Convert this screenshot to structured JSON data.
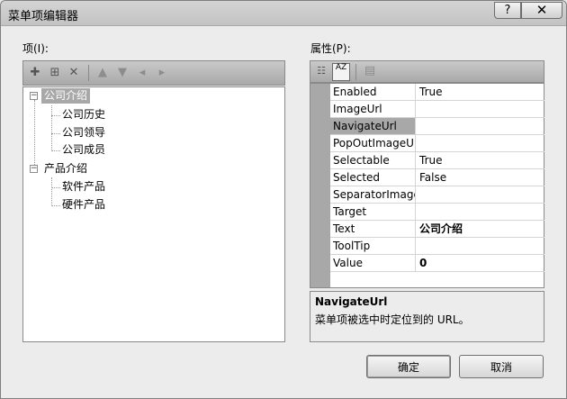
{
  "window": {
    "title": "菜单项编辑器",
    "help_label": "?",
    "close_label": "✕"
  },
  "items_panel": {
    "label": "项(I):",
    "toolbar_icons": [
      "add-root-item-icon",
      "add-child-item-icon",
      "delete-item-icon",
      "move-up-icon",
      "move-down-icon",
      "outdent-icon",
      "indent-icon"
    ],
    "tree": [
      {
        "label": "公司介绍",
        "selected": true,
        "children": [
          "公司历史",
          "公司领导",
          "公司成员"
        ]
      },
      {
        "label": "产品介绍",
        "selected": false,
        "children": [
          "软件产品",
          "硬件产品"
        ]
      }
    ]
  },
  "props_panel": {
    "label": "属性(P):",
    "toolbar_icons": [
      "categorized-icon",
      "alphabetical-sort-icon",
      "property-pages-icon"
    ],
    "sort_label": "AZ",
    "rows": [
      {
        "name": "Enabled",
        "value": "True",
        "bold": false
      },
      {
        "name": "ImageUrl",
        "value": "",
        "bold": false
      },
      {
        "name": "NavigateUrl",
        "value": "",
        "bold": false,
        "selected": true
      },
      {
        "name": "PopOutImageU",
        "value": "",
        "bold": false
      },
      {
        "name": "Selectable",
        "value": "True",
        "bold": false
      },
      {
        "name": "Selected",
        "value": "False",
        "bold": false
      },
      {
        "name": "SeparatorImage",
        "value": "",
        "bold": false
      },
      {
        "name": "Target",
        "value": "",
        "bold": false
      },
      {
        "name": "Text",
        "value": "公司介绍",
        "bold": true
      },
      {
        "name": "ToolTip",
        "value": "",
        "bold": false
      },
      {
        "name": "Value",
        "value": "0",
        "bold": true
      }
    ],
    "description": {
      "title": "NavigateUrl",
      "text": "菜单项被选中时定位到的 URL。"
    }
  },
  "buttons": {
    "ok": "确定",
    "cancel": "取消"
  }
}
